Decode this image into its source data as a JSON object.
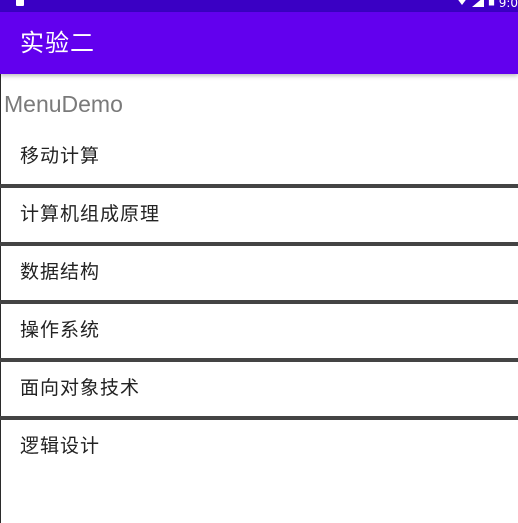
{
  "status_bar": {
    "time": "9:0",
    "icons": [
      "sim-card-icon",
      "wifi-icon",
      "signal-icon",
      "battery-icon"
    ]
  },
  "app_bar": {
    "title": "实验二"
  },
  "main": {
    "subtitle": "MenuDemo",
    "items": [
      {
        "label": "移动计算"
      },
      {
        "label": "计算机组成原理"
      },
      {
        "label": "数据结构"
      },
      {
        "label": "操作系统"
      },
      {
        "label": "面向对象技术"
      },
      {
        "label": "逻辑设计"
      }
    ]
  },
  "colors": {
    "primary": "#6200ee",
    "status_bar": "#3a00c4",
    "divider": "#444444",
    "subtitle": "#7a7a7a",
    "item_text": "#222222"
  }
}
